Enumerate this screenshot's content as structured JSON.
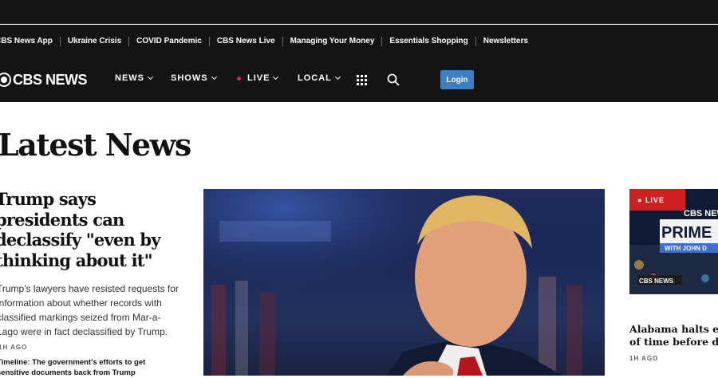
{
  "top_links": [
    "CBS News App",
    "Ukraine Crisis",
    "COVID Pandemic",
    "CBS News Live",
    "Managing Your Money",
    "Essentials Shopping",
    "Newsletters"
  ],
  "logo": {
    "text": "CBS NEWS",
    "icon": "cbs-eye-icon"
  },
  "nav": {
    "news": "NEWS",
    "shows": "SHOWS",
    "live": "LIVE",
    "local": "LOCAL",
    "login": "Login"
  },
  "page_title": "Latest News",
  "lead_story": {
    "headline": "Trump says presidents can declassify \"even by thinking about it\"",
    "dek": "Trump's lawyers have resisted requests for information about whether records with classified markings seized from Mar-a-Lago were in fact declassified by Trump.",
    "time_ago": "1H AGO",
    "related": "Timeline: The government's efforts to get sensitive documents back from Trump"
  },
  "live_card": {
    "badge": "LIVE",
    "channel_logo": "CBS NEWS",
    "show": "PRIME",
    "host_line": "WITH JOHN D",
    "footer_logo": "CBS NEWS"
  },
  "side_story": {
    "headline_lines": [
      "Alabama halts execu",
      "of time before deadl"
    ],
    "time_ago": "1H AGO"
  },
  "colors": {
    "header_bg": "#141414",
    "login_button": "#3d7fc4",
    "live_red": "#d0201f"
  }
}
